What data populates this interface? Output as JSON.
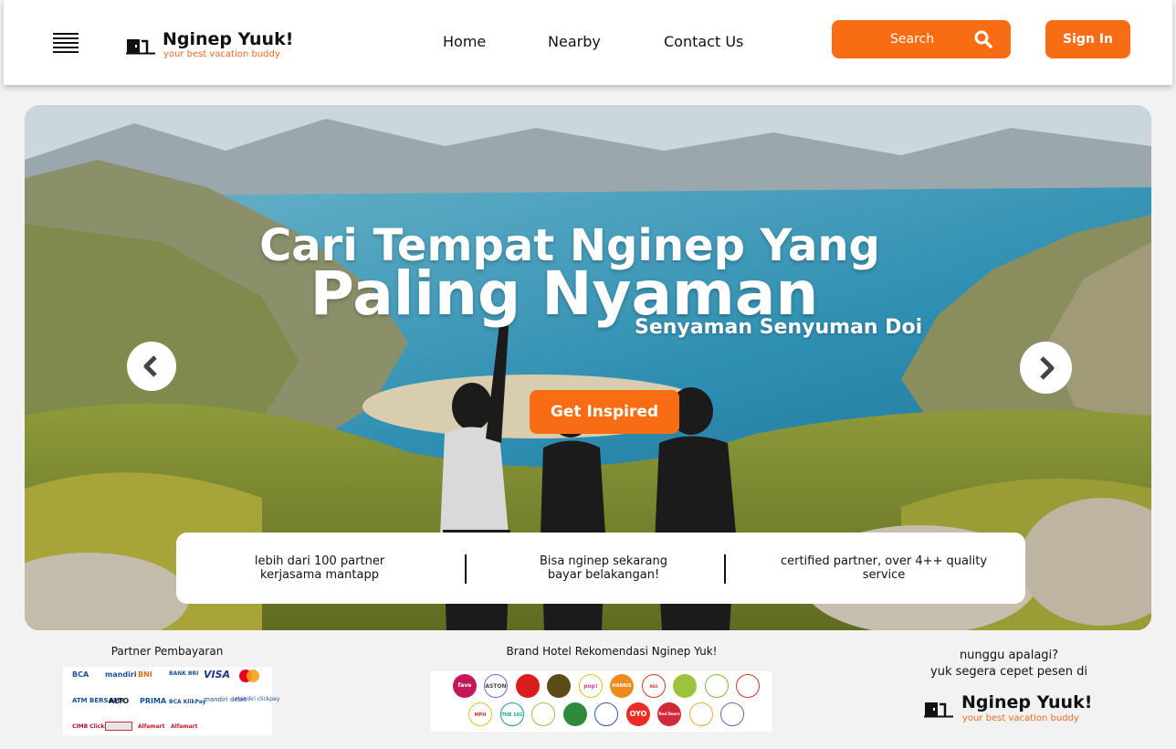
{
  "header": {
    "brand_name": "Nginep Yuuk!",
    "brand_tagline": "your best vacation buddy",
    "nav": [
      {
        "label": "Home"
      },
      {
        "label": "Nearby"
      },
      {
        "label": "Contact Us"
      }
    ],
    "search_label": "Search",
    "signin_label": "Sign In"
  },
  "hero": {
    "title_line1": "Cari Tempat Nginep Yang",
    "title_line2": "Paling Nyaman",
    "subtitle": "Senyaman Senyuman Doi",
    "cta_label": "Get Inspired",
    "features": [
      {
        "line1": "lebih dari 100 partner",
        "line2": "kerjasama mantapp"
      },
      {
        "line1": "Bisa nginep sekarang",
        "line2": "bayar belakangan!"
      },
      {
        "line1": "certified partner, over 4++ quality",
        "line2": "service"
      }
    ]
  },
  "footer": {
    "payment_title": "Partner Pembayaran",
    "payment_partners": [
      "BCA",
      "mandiri",
      "BNI",
      "BANK BRI",
      "VISA",
      "",
      "ATM BERSAMA",
      "ALTO",
      "PRIMA",
      "BCA KlikPay",
      "mandiri debit",
      "mandiri clickpay",
      "CIMB Clicks",
      "",
      "Alfamart",
      "Alfamart"
    ],
    "brand_title": "Brand Hotel Rekomendasi Nginep Yuk!",
    "hotel_brands": [
      "fave",
      "ASTON",
      "",
      "",
      "pop!",
      "HARRIS",
      "RED PLANET",
      "",
      "",
      "",
      "MPH",
      "THE 101",
      "",
      "",
      "",
      "OYO",
      "Red Doorz",
      "",
      ""
    ],
    "cta_line1": "nunggu apalagi?",
    "cta_line2": "yuk segera cepet pesen di",
    "brand_name": "Nginep Yuuk!",
    "brand_tagline": "your best vacation buddy"
  },
  "colors": {
    "accent": "#f86d13",
    "tagline": "#f26b1d"
  }
}
